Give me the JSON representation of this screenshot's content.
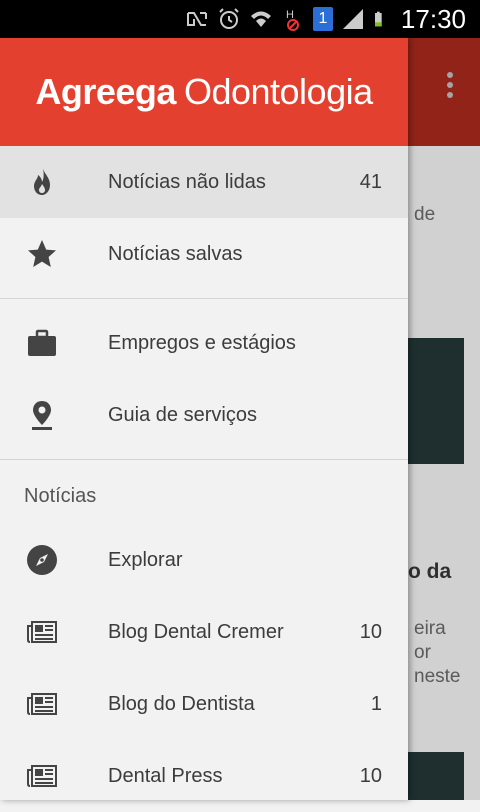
{
  "status_bar": {
    "time": "17:30",
    "icons": [
      "nfc-icon",
      "alarm-icon",
      "wifi-icon",
      "hspa-icon",
      "sim-1-icon",
      "signal-icon",
      "battery-icon"
    ],
    "sim_number": "1",
    "network_type": "H"
  },
  "colors": {
    "header_red": "#e4402f",
    "background_toolbar": "#b22b1f"
  },
  "drawer": {
    "brand_bold": "Agreega",
    "brand_light": "Odontologia",
    "top_items": [
      {
        "label": "Notícias não lidas",
        "count": "41",
        "icon": "fire-icon",
        "active": true
      },
      {
        "label": "Notícias salvas",
        "count": "",
        "icon": "star-icon"
      }
    ],
    "tools": [
      {
        "label": "Empregos e estágios",
        "icon": "briefcase-icon"
      },
      {
        "label": "Guia de serviços",
        "icon": "location-pin-icon"
      }
    ],
    "section_title": "Notícias",
    "feeds": [
      {
        "label": "Explorar",
        "count": "",
        "icon": "compass-icon"
      },
      {
        "label": "Blog Dental Cremer",
        "count": "10",
        "icon": "newspaper-icon"
      },
      {
        "label": "Blog do Dentista",
        "count": "1",
        "icon": "newspaper-icon"
      },
      {
        "label": "Dental Press",
        "count": "10",
        "icon": "newspaper-icon"
      }
    ]
  },
  "background": {
    "text_1": "de",
    "title_1": "o da",
    "text_2": "eira",
    "text_3": "or",
    "text_4": "neste"
  }
}
